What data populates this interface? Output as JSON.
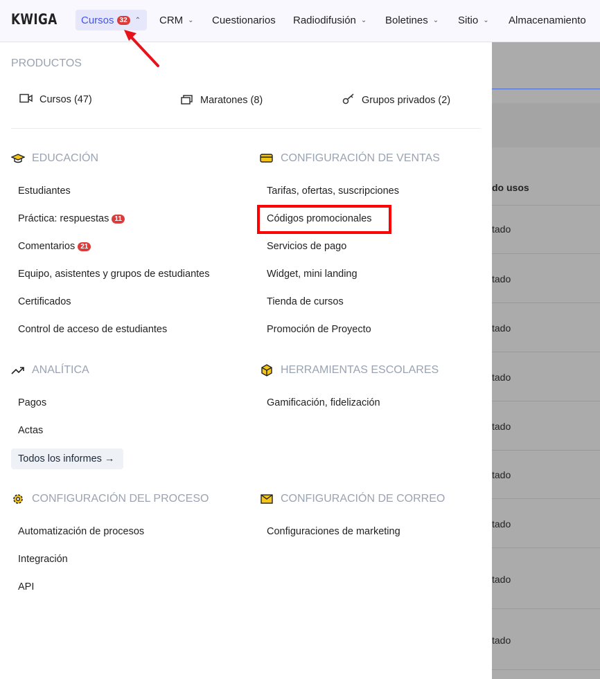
{
  "nav": {
    "logo": "KWIGA",
    "items": [
      {
        "label": "Cursos",
        "badge": "32"
      },
      {
        "label": "CRM"
      },
      {
        "label": "Cuestionarios"
      },
      {
        "label": "Radiodifusión"
      },
      {
        "label": "Boletines"
      },
      {
        "label": "Sitio"
      },
      {
        "label": "Almacenamiento"
      }
    ]
  },
  "products": {
    "title": "PRODUCTOS",
    "items": [
      {
        "label": "Cursos (47)",
        "icon": "video-icon"
      },
      {
        "label": "Maratones (8)",
        "icon": "stack-icon"
      },
      {
        "label": "Grupos privados (2)",
        "icon": "key-icon"
      }
    ]
  },
  "sections": {
    "educacion": {
      "title": "EDUCACIÓN",
      "items": [
        "Estudiantes",
        "Práctica: respuestas",
        "Comentarios",
        "Equipo, asistentes y grupos de estudiantes",
        "Certificados",
        "Control de acceso de estudiantes"
      ],
      "badges": {
        "practica": "11",
        "comentarios": "21"
      }
    },
    "ventas": {
      "title": "CONFIGURACIÓN DE VENTAS",
      "items": [
        "Tarifas, ofertas, suscripciones",
        "Códigos promocionales",
        "Servicios de pago",
        "Widget, mini landing",
        "Tienda de cursos",
        "Promoción de Proyecto"
      ]
    },
    "analitica": {
      "title": "ANALÍTICA",
      "items": [
        "Pagos",
        "Actas"
      ],
      "all_reports": "Todos los informes →"
    },
    "herramientas": {
      "title": "HERRAMIENTAS ESCOLARES",
      "items": [
        "Gamificación, fidelización"
      ]
    },
    "proceso": {
      "title": "CONFIGURACIÓN DEL PROCESO",
      "items": [
        "Automatización de procesos",
        "Integración",
        "API"
      ]
    },
    "correo": {
      "title": "CONFIGURACIÓN DE CORREO",
      "items": [
        "Configuraciones de marketing"
      ]
    }
  },
  "background": {
    "column_header": "do usos",
    "cell": "tado"
  },
  "colors": {
    "accent": "#4455e8",
    "badge": "#dc3b3b",
    "highlight": "#ff0000",
    "icon_yellow": "#f5c518"
  }
}
